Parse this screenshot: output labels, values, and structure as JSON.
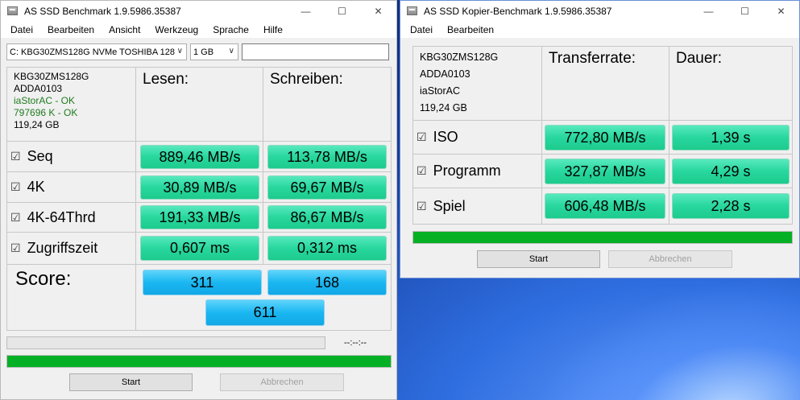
{
  "main": {
    "title": "AS SSD Benchmark 1.9.5986.35387",
    "menu": [
      "Datei",
      "Bearbeiten",
      "Ansicht",
      "Werkzeug",
      "Sprache",
      "Hilfe"
    ],
    "drive_select": "C: KBG30ZMS128G NVMe TOSHIBA 128",
    "size_select": "1 GB",
    "info": {
      "model": "KBG30ZMS128G",
      "firmware": "ADDA0103",
      "driver": "iaStorAC - OK",
      "alignment": "797696 K - OK",
      "capacity": "119,24 GB"
    },
    "headers": {
      "read": "Lesen:",
      "write": "Schreiben:"
    },
    "rows": [
      {
        "label": "Seq",
        "read": "889,46 MB/s",
        "write": "113,78 MB/s"
      },
      {
        "label": "4K",
        "read": "30,89 MB/s",
        "write": "69,67 MB/s"
      },
      {
        "label": "4K-64Thrd",
        "read": "191,33 MB/s",
        "write": "86,67 MB/s"
      },
      {
        "label": "Zugriffszeit",
        "read": "0,607 ms",
        "write": "0,312 ms"
      }
    ],
    "score": {
      "label": "Score:",
      "read": "311",
      "write": "168",
      "total": "611"
    },
    "time_readout": "--:--:--",
    "progress_top": 0,
    "progress_bottom": 1,
    "start_label": "Start",
    "abort_label": "Abbrechen",
    "checkbox_glyph": "☑",
    "colors": {
      "value_box": "#27d79d",
      "score_box": "#1ab7f1",
      "progress": "#06b025",
      "ok_text": "#1f7b1f"
    }
  },
  "copy": {
    "title": "AS SSD Kopier-Benchmark 1.9.5986.35387",
    "menu": [
      "Datei",
      "Bearbeiten"
    ],
    "info": {
      "model": "KBG30ZMS128G",
      "firmware": "ADDA0103",
      "driver": "iaStorAC",
      "capacity": "119,24 GB"
    },
    "headers": {
      "rate": "Transferrate:",
      "duration": "Dauer:"
    },
    "rows": [
      {
        "label": "ISO",
        "rate": "772,80 MB/s",
        "duration": "1,39 s"
      },
      {
        "label": "Programm",
        "rate": "327,87 MB/s",
        "duration": "4,29 s"
      },
      {
        "label": "Spiel",
        "rate": "606,48 MB/s",
        "duration": "2,28 s"
      }
    ],
    "progress": 1,
    "start_label": "Start",
    "abort_label": "Abbrechen"
  }
}
